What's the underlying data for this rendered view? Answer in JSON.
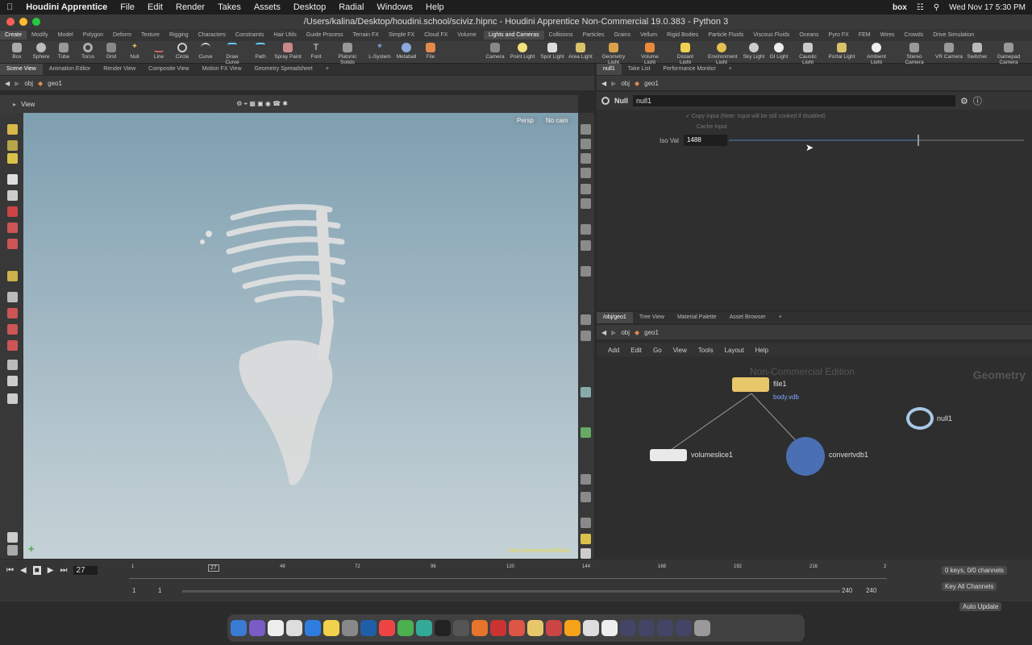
{
  "menubar": {
    "app": "Houdini Apprentice",
    "items": [
      "File",
      "Edit",
      "Render",
      "Takes",
      "Assets",
      "Desktop",
      "Radial",
      "Windows",
      "Help"
    ],
    "box": "box",
    "clock": "Wed Nov 17  5:30 PM"
  },
  "window": {
    "title": "/Users/kalina/Desktop/houdini.school/sciviz.hipnc - Houdini Apprentice Non-Commercial 19.0.383 - Python 3"
  },
  "shelf_tabs_left": [
    "Create",
    "Modify",
    "Model",
    "Polygon",
    "Deform",
    "Texture",
    "Rigging",
    "Characters",
    "Constraints",
    "Hair Utils",
    "Guide Process",
    "Terrain FX",
    "Simple FX",
    "Cloud FX",
    "Volume"
  ],
  "shelf_tabs_right": [
    "Lights and Cameras",
    "Collisions",
    "Particles",
    "Grains",
    "Vellum",
    "Rigid Bodies",
    "Particle Fluids",
    "Viscous Fluids",
    "Oceans",
    "Pyro FX",
    "FEM",
    "Wires",
    "Crowds",
    "Drive Simulation"
  ],
  "tools_left": [
    "Box",
    "Sphere",
    "Tube",
    "Torus",
    "Grid",
    "Null",
    "Line",
    "Circle",
    "Curve",
    "Draw Curve",
    "Path",
    "Spray Paint",
    "Font",
    "Platonic Solids",
    "L-System",
    "Metaball",
    "File"
  ],
  "tools_right": [
    "Camera",
    "Point Light",
    "Spot Light",
    "Area Light",
    "Geometry Light",
    "Volume Light",
    "Distant Light",
    "Environment Light",
    "Sky Light",
    "GI Light",
    "Caustic Light",
    "Portal Light",
    "Ambient Light",
    "Stereo Camera",
    "VR Camera",
    "Switcher",
    "Gamepad Camera"
  ],
  "left_pane_tabs": [
    "Scene View",
    "Animation Editor",
    "Render View",
    "Composite View",
    "Motion FX View",
    "Geometry Spreadsheet"
  ],
  "left_path": {
    "obj": "obj",
    "geo": "geo1"
  },
  "viewport": {
    "label": "View",
    "persp": "Persp",
    "cam": "No cam",
    "watermark": "Non-Commercial Edition"
  },
  "parm_tabs": [
    "null1",
    "Take List",
    "Performance Monitor"
  ],
  "parm_path": {
    "obj": "obj",
    "geo": "geo1"
  },
  "parm": {
    "type": "Null",
    "name": "null1",
    "copy_input": "Copy Input (Note: Input will be still cooked if disabled)",
    "cache_input": "Cache Input",
    "iso_label": "Iso Val",
    "iso_value": "1488",
    "iso_fraction": 0.64
  },
  "net_tabs": [
    "/obj/geo1",
    "Tree View",
    "Material Palette",
    "Asset Browser"
  ],
  "net_path": {
    "obj": "obj",
    "geo": "geo1"
  },
  "net_menu": [
    "Add",
    "Edit",
    "Go",
    "View",
    "Tools",
    "Layout",
    "Help"
  ],
  "network": {
    "watermark": "Non-Commercial Edition",
    "context": "Geometry",
    "nodes": {
      "file": "file1",
      "file_sub": "body.vdb",
      "volumeslice": "volumeslice1",
      "convertvdb": "convertvdb1",
      "null": "null1"
    }
  },
  "timeline": {
    "frame": "27",
    "ticks": [
      "1",
      "27",
      "48",
      "72",
      "96",
      "120",
      "144",
      "168",
      "192",
      "216",
      "2"
    ],
    "start": "1",
    "start2": "1",
    "end": "240",
    "end2": "240",
    "keys": "0 keys, 0/0 channels",
    "key_all": "Key All Channels",
    "auto_update": "Auto Update"
  },
  "colors": {
    "accent": "#e8c66a",
    "node_null": "#a9c8e6",
    "node_vdb": "#4a6fb3"
  }
}
